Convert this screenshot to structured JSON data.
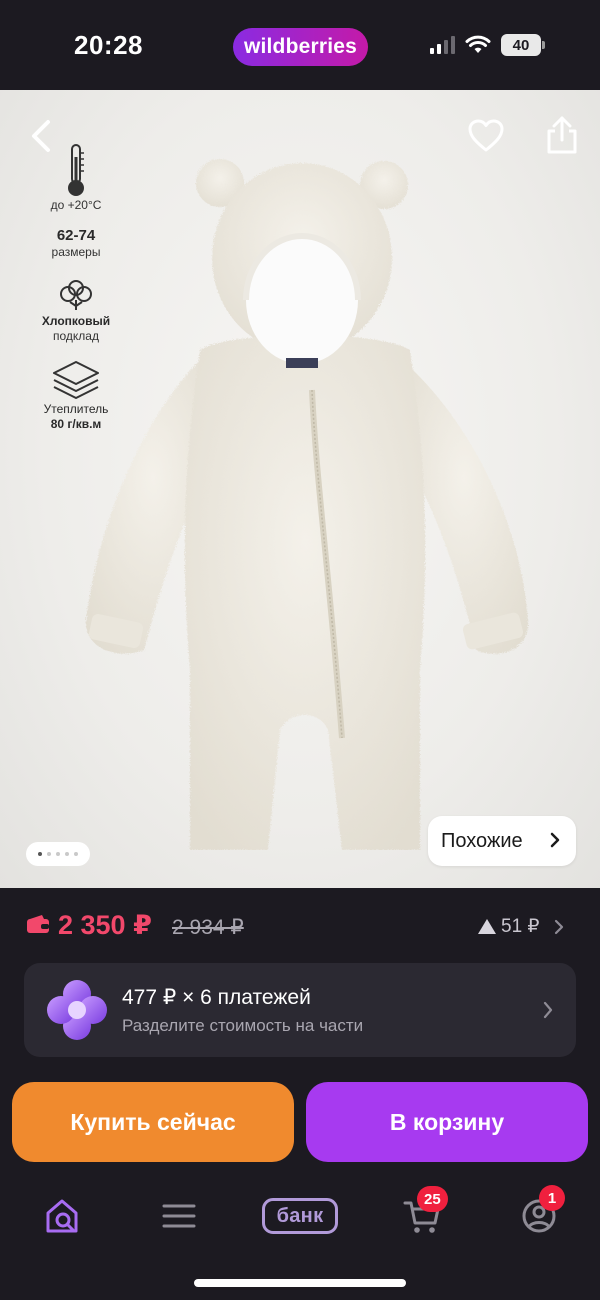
{
  "status_bar": {
    "time": "20:28",
    "brand": "wildberries",
    "battery": "40"
  },
  "product": {
    "features": [
      {
        "icon": "thermometer-icon",
        "main": "",
        "sub": "до +20°C"
      },
      {
        "icon": "",
        "main": "62-74",
        "sub": "размеры"
      },
      {
        "icon": "cotton-icon",
        "main": "Хлопковый",
        "sub": "подклад"
      },
      {
        "icon": "layers-icon",
        "main": "Утеплитель",
        "sub": "80 г/кв.м"
      }
    ],
    "similar_label": "Похожие",
    "gallery_total": 5,
    "gallery_active": 1
  },
  "price": {
    "current": "2 350 ₽",
    "old": "2 934 ₽",
    "points": "51 ₽",
    "accent_color": "#f2486b"
  },
  "installments": {
    "title": "477 ₽ × 6 платежей",
    "subtitle": "Разделите стоимость на части"
  },
  "actions": {
    "buy_now": "Купить сейчас",
    "to_cart": "В корзину",
    "buy_color": "#f08a2e",
    "cart_color": "#a73af0"
  },
  "tab_bar": {
    "bank_label": "банк",
    "cart_badge": "25",
    "profile_badge": "1",
    "active_color": "#a86cf2"
  }
}
